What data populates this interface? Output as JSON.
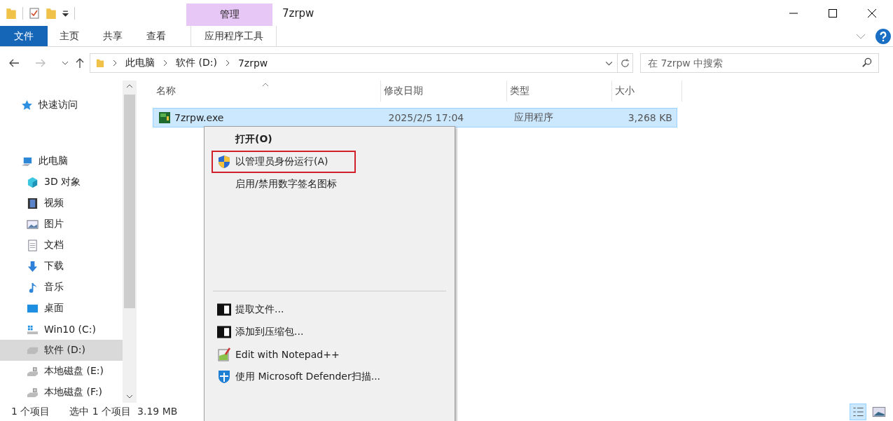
{
  "window": {
    "title": "7zrpw",
    "contextual_tab": "管理"
  },
  "ribbon_tabs": [
    {
      "label": "文件",
      "kind": "file"
    },
    {
      "label": "主页",
      "kind": "plain"
    },
    {
      "label": "共享",
      "kind": "plain"
    },
    {
      "label": "查看",
      "kind": "plain"
    },
    {
      "label": "应用程序工具",
      "kind": "contextual"
    }
  ],
  "address": {
    "crumbs": [
      "此电脑",
      "软件 (D:)",
      "7zrpw"
    ]
  },
  "search": {
    "placeholder": "在 7zrpw 中搜索"
  },
  "sidebar": {
    "items": [
      {
        "label": "快速访问",
        "kind": "star",
        "selected": false
      },
      {
        "label": "此电脑",
        "kind": "pc",
        "selected": false,
        "children": [
          {
            "label": "3D 对象",
            "kind": "cube",
            "selected": false
          },
          {
            "label": "视频",
            "kind": "film",
            "selected": false
          },
          {
            "label": "图片",
            "kind": "image",
            "selected": false
          },
          {
            "label": "文档",
            "kind": "doc",
            "selected": false
          },
          {
            "label": "下载",
            "kind": "download",
            "selected": false
          },
          {
            "label": "音乐",
            "kind": "music",
            "selected": false
          },
          {
            "label": "桌面",
            "kind": "desktop",
            "selected": false
          },
          {
            "label": "Win10 (C:)",
            "kind": "windrive",
            "selected": false
          },
          {
            "label": "软件 (D:)",
            "kind": "drive",
            "selected": true
          },
          {
            "label": "本地磁盘 (E:)",
            "kind": "lockdrive",
            "selected": false
          },
          {
            "label": "本地磁盘 (F:)",
            "kind": "lockdrive",
            "selected": false
          }
        ]
      }
    ]
  },
  "table": {
    "columns": [
      "名称",
      "修改日期",
      "类型",
      "大小"
    ],
    "rows": [
      {
        "name": "7zrpw.exe",
        "modified": "2025/2/5 17:04",
        "type": "应用程序",
        "size": "3,268 KB",
        "selected": true
      }
    ]
  },
  "context_menu": {
    "items": [
      {
        "label": "打开(O)",
        "kind": "default",
        "highlighted": false
      },
      {
        "label": "以管理员身份运行(A)",
        "kind": "shield",
        "highlighted": true
      },
      {
        "label": "启用/禁用数字签名图标",
        "kind": "plain",
        "highlighted": false
      },
      {
        "kind": "blank"
      },
      {
        "kind": "separator"
      },
      {
        "label": "提取文件...",
        "kind": "sevenzip",
        "highlighted": false
      },
      {
        "label": "添加到压缩包...",
        "kind": "sevenzip",
        "highlighted": false
      },
      {
        "label": "Edit with Notepad++",
        "kind": "notepad",
        "highlighted": false
      },
      {
        "label": "使用 Microsoft Defender扫描...",
        "kind": "defender",
        "highlighted": false
      }
    ]
  },
  "status_bar": {
    "count": "1 个项目",
    "selection": "选中 1 个项目  3.19 MB"
  }
}
